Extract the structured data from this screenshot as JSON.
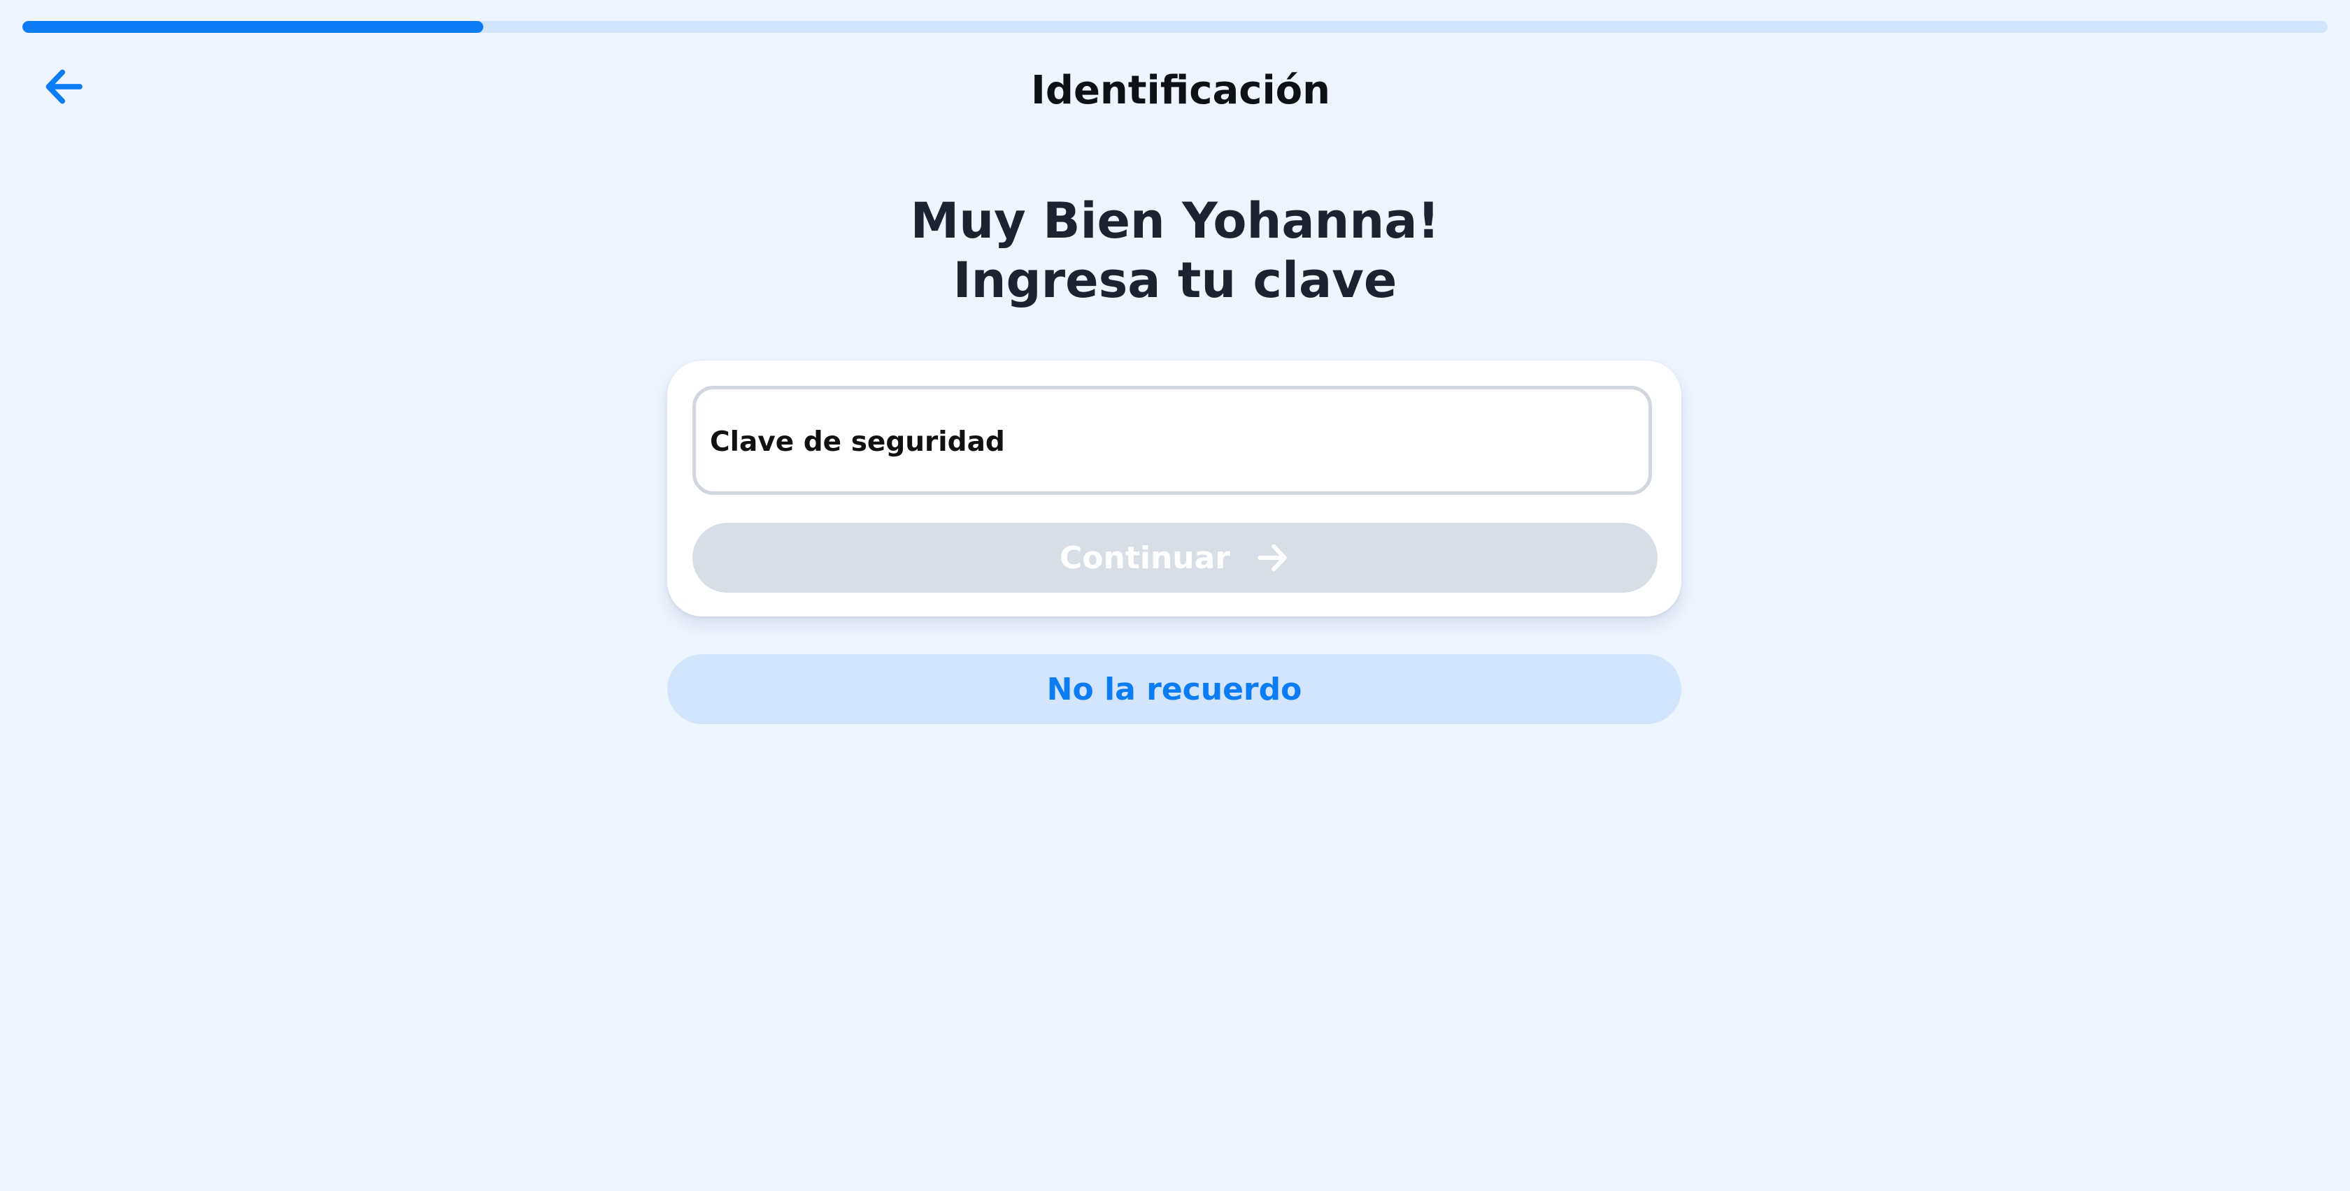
{
  "progress": {
    "fraction": 0.2
  },
  "header": {
    "title": "Identificación",
    "back_icon": "arrow-left-icon"
  },
  "heading": {
    "line1": "Muy Bien Yohanna!",
    "line2": "Ingresa tu clave"
  },
  "form": {
    "password_placeholder": "Clave de seguridad",
    "password_value": "",
    "continue_label": "Continuar",
    "continue_icon": "arrow-right-icon",
    "continue_enabled": false
  },
  "forgot": {
    "label": "No la recuerdo"
  },
  "colors": {
    "accent": "#0c7cf5",
    "background": "#eef5ff",
    "progress_track": "#d3e5fd",
    "button_disabled": "#d8dee6",
    "secondary_button": "#d2e5fc",
    "heading_text": "#1b2230"
  }
}
